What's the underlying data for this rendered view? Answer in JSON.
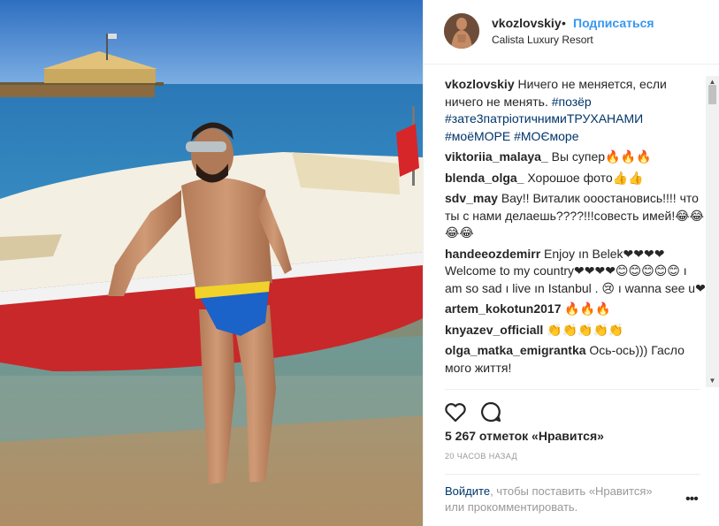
{
  "header": {
    "username": "vkozlovskiy",
    "separator": "•",
    "follow_label": "Подписаться",
    "location": "Calista Luxury Resort"
  },
  "comments": [
    {
      "user": "vkozlovskiy",
      "text": "Ничего не меняется, если ничего не менять.",
      "hashtags": "#позёр #зате3патріотичнимиТРУХАНАМИ #моёМОРЕ #МОЄморе"
    },
    {
      "user": "viktoriia_malaya_",
      "text": "Вы супер🔥🔥🔥"
    },
    {
      "user": "blenda_olga_",
      "text": "Хорошое фото👍👍"
    },
    {
      "user": "sdv_may",
      "text": "Вау!! Виталик ооостановись!!!! что ты с нами делаешь????!!!совесть имей!😂😂😂😂"
    },
    {
      "user": "handeeozdemirr",
      "text": "Enjoy ın Belek❤❤❤❤ Welcome to my country❤❤❤❤😊😊😊😊😊 ı am so sad ı live ın Istanbul . 😢 ı wanna see u❤"
    },
    {
      "user": "artem_kokotun2017",
      "text": "🔥🔥🔥"
    },
    {
      "user": "knyazev_officiall",
      "text": "👏👏👏👏👏"
    },
    {
      "user": "olga_matka_emigrantka",
      "text": "Ось-ось))) Гасло мого життя!"
    }
  ],
  "actions": {
    "likes_text": "5 267 отметок «Нравится»",
    "time_text": "20 ЧАСОВ НАЗАД",
    "login_link": "Войдите",
    "login_rest": ", чтобы поставить «Нравится» или прокомментировать.",
    "more_label": "•••"
  },
  "icons": {
    "like": "heart-outline-icon",
    "comment": "speech-bubble-icon",
    "more": "more-options-icon"
  },
  "colors": {
    "link_blue": "#3897f0",
    "hashtag": "#003569",
    "muted": "#999999"
  }
}
